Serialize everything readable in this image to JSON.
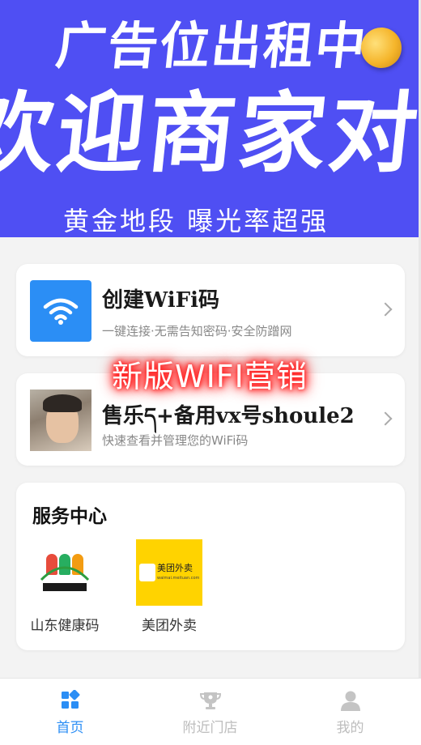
{
  "banner": {
    "line1": "广告位出租中",
    "line2": "欢迎商家对接",
    "line3": "黄金地段  曝光率超强"
  },
  "cards": {
    "wifi": {
      "title": "创建WiFi码",
      "subtitle": "一键连接·无需告知密码·安全防蹭网"
    },
    "user": {
      "title": "售乐ད+备用vx号shoule2",
      "subtitle": "快速查看并管理您的WiFi码"
    }
  },
  "promo": "新版WIFI营销",
  "service": {
    "title": "服务中心",
    "items": [
      {
        "label": "山东健康码",
        "icon": "shandong-health-code-logo"
      },
      {
        "label": "美团外卖",
        "icon": "meituan-waimai-logo",
        "logo_text": "美团外卖",
        "logo_url": "waimai.meituan.com"
      }
    ]
  },
  "tabbar": {
    "active": "home",
    "items": [
      {
        "label": "首页",
        "icon": "home-grid-icon"
      },
      {
        "label": "附近门店",
        "icon": "trophy-icon"
      },
      {
        "label": "我的",
        "icon": "user-icon"
      }
    ]
  },
  "colors": {
    "banner_bg": "#4f4ff3",
    "accent": "#2b8ef5",
    "promo_glow": "#ff2020",
    "meituan_yellow": "#ffd300"
  }
}
